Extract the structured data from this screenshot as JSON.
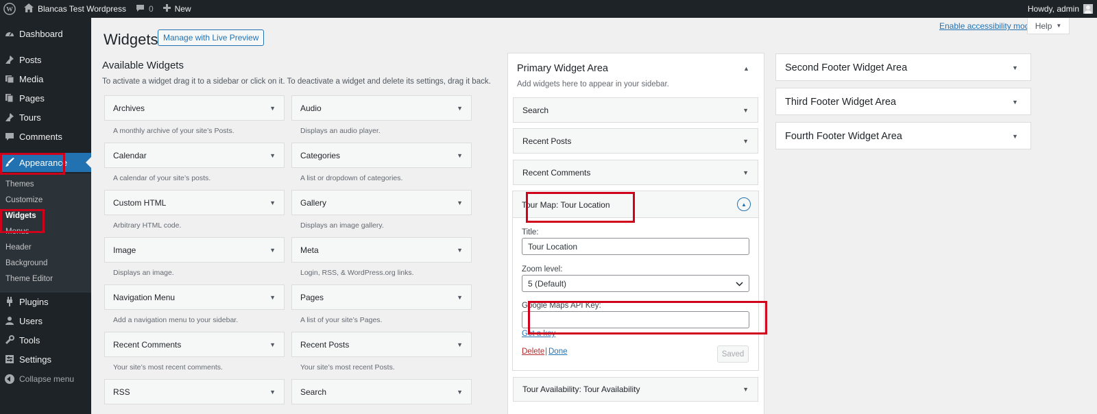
{
  "adminbar": {
    "site_name": "Blancas Test Wordpress",
    "comments_count": "0",
    "new_label": "New",
    "howdy": "Howdy, admin"
  },
  "sidebar": {
    "items": [
      {
        "label": "Dashboard",
        "icon": "dashboard-icon"
      },
      {
        "label": "Posts",
        "icon": "pin-icon"
      },
      {
        "label": "Media",
        "icon": "media-icon"
      },
      {
        "label": "Pages",
        "icon": "pages-icon"
      },
      {
        "label": "Tours",
        "icon": "pin-icon"
      },
      {
        "label": "Comments",
        "icon": "comments-icon"
      },
      {
        "label": "Appearance",
        "icon": "appearance-icon"
      },
      {
        "label": "Plugins",
        "icon": "plugins-icon"
      },
      {
        "label": "Users",
        "icon": "users-icon"
      },
      {
        "label": "Tools",
        "icon": "tools-icon"
      },
      {
        "label": "Settings",
        "icon": "settings-icon"
      }
    ],
    "submenu": [
      "Themes",
      "Customize",
      "Widgets",
      "Menus",
      "Header",
      "Background",
      "Theme Editor"
    ],
    "collapse_label": "Collapse menu",
    "highlight_color": "#d0021b",
    "accent_color": "#2271b1"
  },
  "header": {
    "title": "Widgets",
    "live_preview_label": "Manage with Live Preview",
    "accessibility_link": "Enable accessibility mode",
    "help_label": "Help"
  },
  "available": {
    "title": "Available Widgets",
    "description": "To activate a widget drag it to a sidebar or click on it. To deactivate a widget and delete its settings, drag it back.",
    "widgets": [
      {
        "name": "Archives",
        "desc": "A monthly archive of your site’s Posts."
      },
      {
        "name": "Audio",
        "desc": "Displays an audio player."
      },
      {
        "name": "Calendar",
        "desc": "A calendar of your site’s posts."
      },
      {
        "name": "Categories",
        "desc": "A list or dropdown of categories."
      },
      {
        "name": "Custom HTML",
        "desc": "Arbitrary HTML code."
      },
      {
        "name": "Gallery",
        "desc": "Displays an image gallery."
      },
      {
        "name": "Image",
        "desc": "Displays an image."
      },
      {
        "name": "Meta",
        "desc": "Login, RSS, & WordPress.org links."
      },
      {
        "name": "Navigation Menu",
        "desc": "Add a navigation menu to your sidebar."
      },
      {
        "name": "Pages",
        "desc": "A list of your site’s Pages."
      },
      {
        "name": "Recent Comments",
        "desc": "Your site’s most recent comments."
      },
      {
        "name": "Recent Posts",
        "desc": "Your site’s most recent Posts."
      },
      {
        "name": "RSS",
        "desc": ""
      },
      {
        "name": "Search",
        "desc": ""
      }
    ]
  },
  "primary": {
    "title": "Primary Widget Area",
    "description": "Add widgets here to appear in your sidebar.",
    "widgets": [
      "Search",
      "Recent Posts",
      "Recent Comments"
    ],
    "open_widget": {
      "type": "Tour Map:",
      "name": "Tour Location",
      "title_label": "Title:",
      "title_value": "Tour Location",
      "zoom_label": "Zoom level:",
      "zoom_value": "5 (Default)",
      "api_key_label": "Google Maps API Key:",
      "api_key_value": "",
      "get_key_link": "Get a key",
      "delete_link": "Delete",
      "separator": "|",
      "done_link": "Done",
      "saved_button": "Saved"
    },
    "last_widget": {
      "type": "Tour Availability:",
      "name": "Tour Availability"
    }
  },
  "footer_areas": [
    "Second Footer Widget Area",
    "Third Footer Widget Area",
    "Fourth Footer Widget Area"
  ]
}
